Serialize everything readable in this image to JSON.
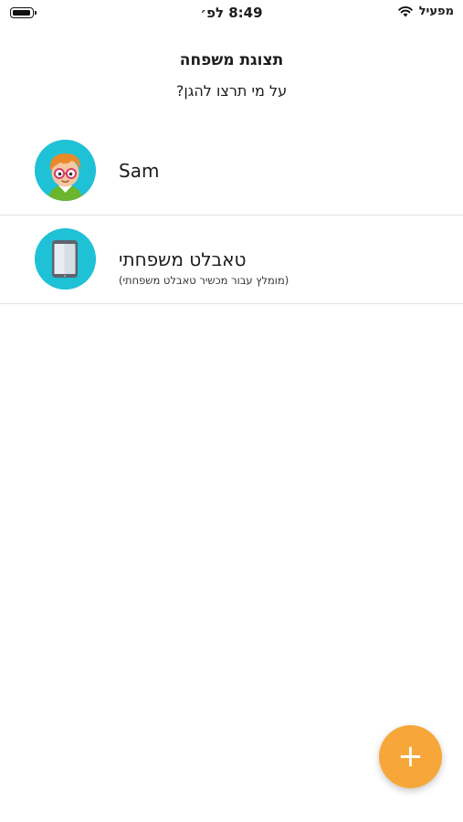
{
  "status_bar": {
    "time": "8:49 לפ׳",
    "carrier": "מפעיל",
    "icons": [
      "battery-icon",
      "wifi-icon"
    ]
  },
  "header": {
    "title": "תצוגת משפחה",
    "subtitle": "על מי תרצו להגן?"
  },
  "profiles": [
    {
      "name": "Sam",
      "avatar": "child-avatar-icon"
    },
    {
      "name": "טאבלט משפחתי",
      "note": "(מומלץ עבור מכשיר טאבלט משפחתי)",
      "avatar": "tablet-icon"
    }
  ],
  "fab": {
    "label": "+",
    "icon": "plus-icon",
    "color": "#f7a73a"
  },
  "colors": {
    "avatar_bg": "#1fc1d6",
    "divider": "#e4e4e4",
    "accent": "#f7a73a"
  }
}
